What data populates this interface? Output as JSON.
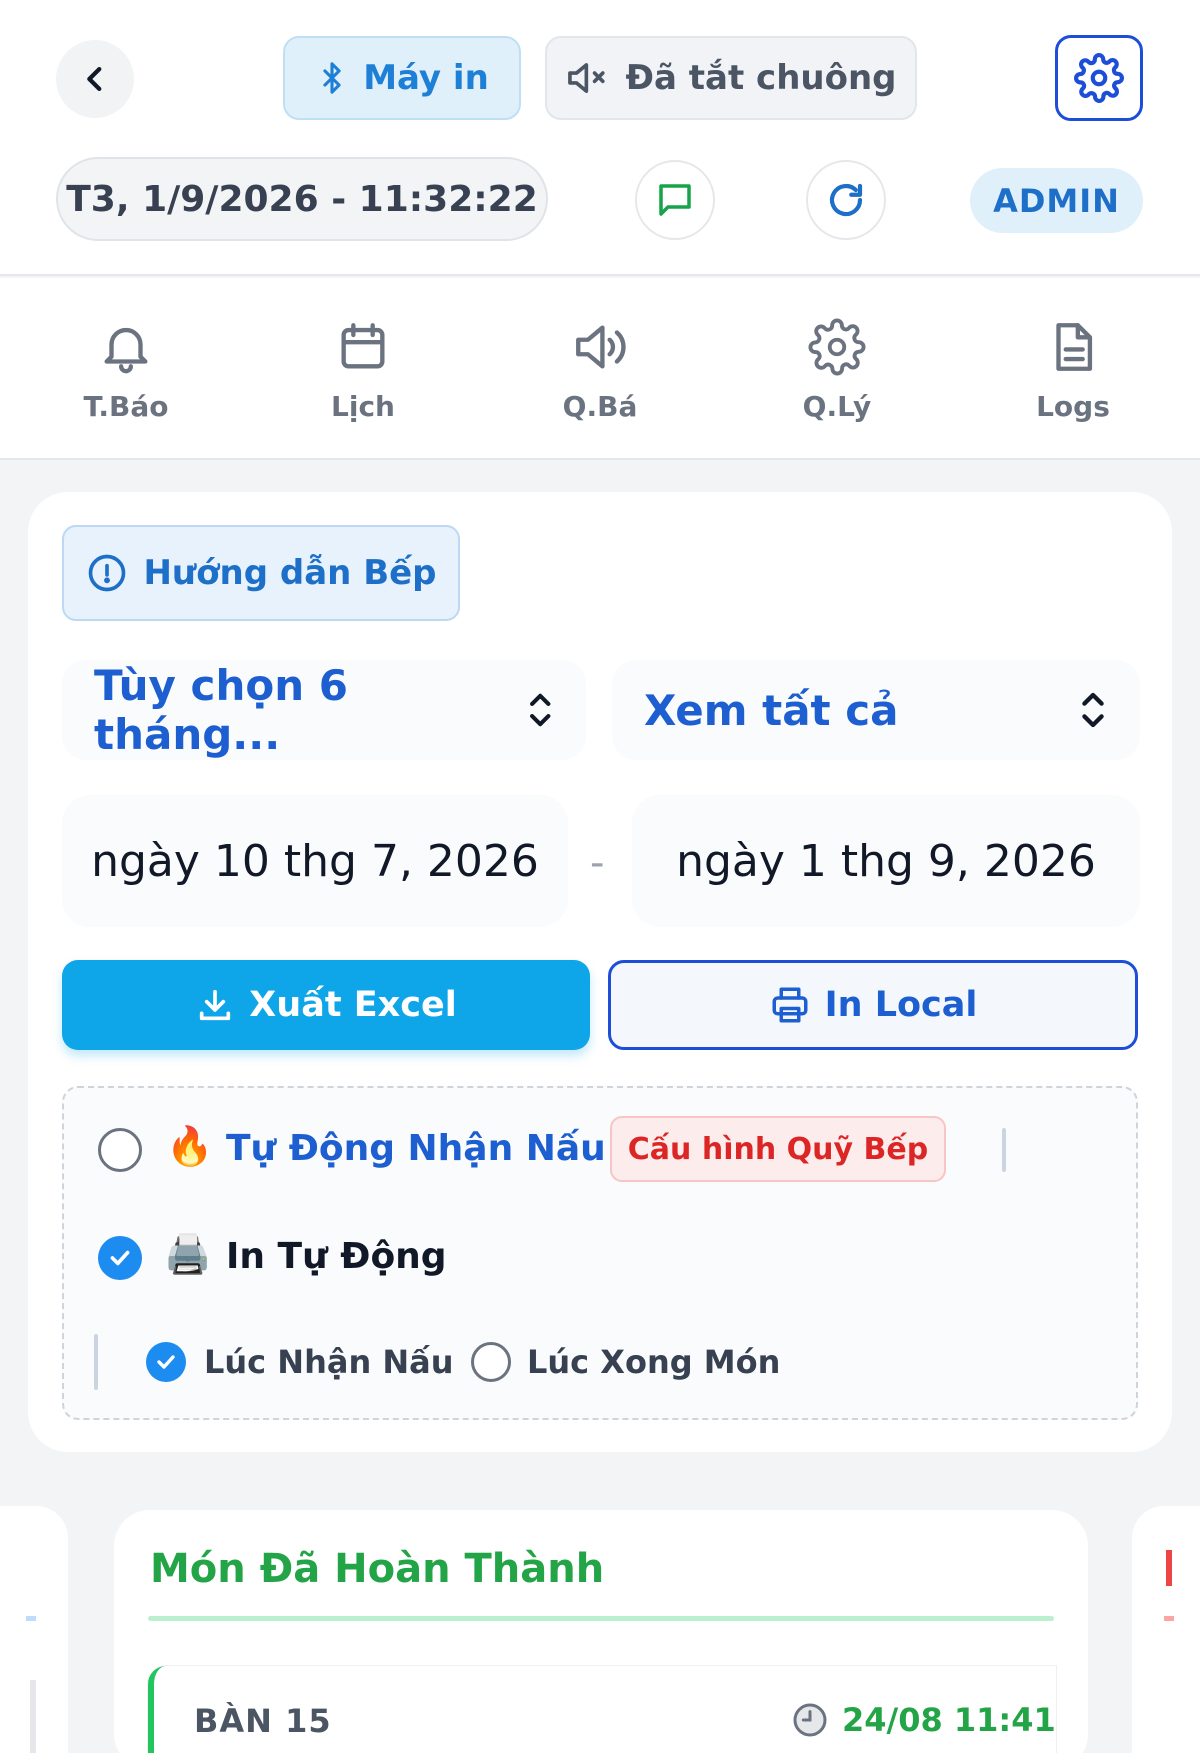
{
  "header": {
    "printer_label": "Máy in",
    "mute_label": "Đã tắt chuông",
    "datetime": "T3, 1/9/2026 - 11:32:22",
    "role_badge": "ADMIN"
  },
  "nav": {
    "items": [
      {
        "label": "T.Báo",
        "icon": "bell-icon"
      },
      {
        "label": "Lịch",
        "icon": "calendar-icon"
      },
      {
        "label": "Q.Bá",
        "icon": "speaker-icon"
      },
      {
        "label": "Q.Lý",
        "icon": "gear-icon"
      },
      {
        "label": "Logs",
        "icon": "document-icon"
      }
    ]
  },
  "filters": {
    "guide_label": "Hướng dẫn Bếp",
    "range_select": "Tùy chọn 6 tháng...",
    "view_select": "Xem tất cả",
    "date_from": "ngày 10 thg 7, 2026",
    "date_separator": "-",
    "date_to": "ngày 1 thg 9, 2026",
    "export_excel_label": "Xuất Excel",
    "print_local_label": "In Local"
  },
  "options": {
    "auto_cook": {
      "label": "Tự Động Nhận Nấu",
      "emoji": "🔥",
      "checked": false
    },
    "kitchen_config_label": "Cấu hình Quỹ Bếp",
    "auto_print": {
      "label": "In Tự Động",
      "emoji": "🖨️",
      "checked": true
    },
    "print_on_accept": {
      "label": "Lúc Nhận Nấu",
      "checked": true
    },
    "print_on_done": {
      "label": "Lúc Xong Món",
      "checked": false
    }
  },
  "completed": {
    "title": "Món Đã Hoàn Thành",
    "orders": [
      {
        "table": "BÀN 15",
        "time": "24/08 11:41"
      }
    ]
  },
  "colors": {
    "accent_blue": "#1d4ed8",
    "excel_blue": "#0ea5e9",
    "done_green": "#22a447",
    "config_red": "#dc2626"
  }
}
